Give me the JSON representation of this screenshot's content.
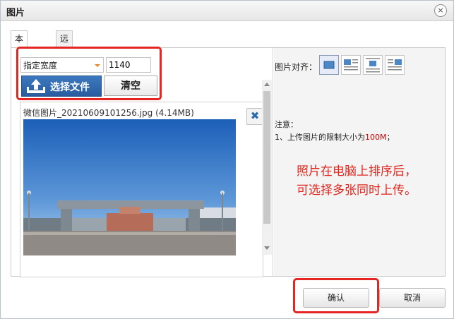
{
  "dialog": {
    "title": "图片",
    "close_symbol": "×"
  },
  "tabs": [
    {
      "label": "本地上传",
      "active": true
    },
    {
      "label": "远程图片",
      "active": false
    }
  ],
  "upload": {
    "width_mode": "指定宽度",
    "width_value": "1140",
    "choose_label": "选择文件",
    "clear_label": "清空",
    "file_name": "微信图片_20210609101256.jpg (4.14MB)",
    "remove_symbol": "✖"
  },
  "options": {
    "align_label": "图片对齐：",
    "align_icons": [
      "align-none-icon",
      "align-left-icon",
      "align-center-icon",
      "align-right-icon"
    ],
    "notice_title": "注意：",
    "notice_line": "1、上传图片的限制大小为",
    "notice_limit": "100M",
    "notice_end": "；"
  },
  "annotation": {
    "line1": "照片在电脑上排序后，",
    "line2": "可选择多张同时上传。"
  },
  "footer": {
    "ok_label": "确认",
    "cancel_label": "取消"
  },
  "colors": {
    "highlight_red": "#e52521",
    "primary_blue": "#2f67aa",
    "annotation_red": "#e0261d"
  }
}
